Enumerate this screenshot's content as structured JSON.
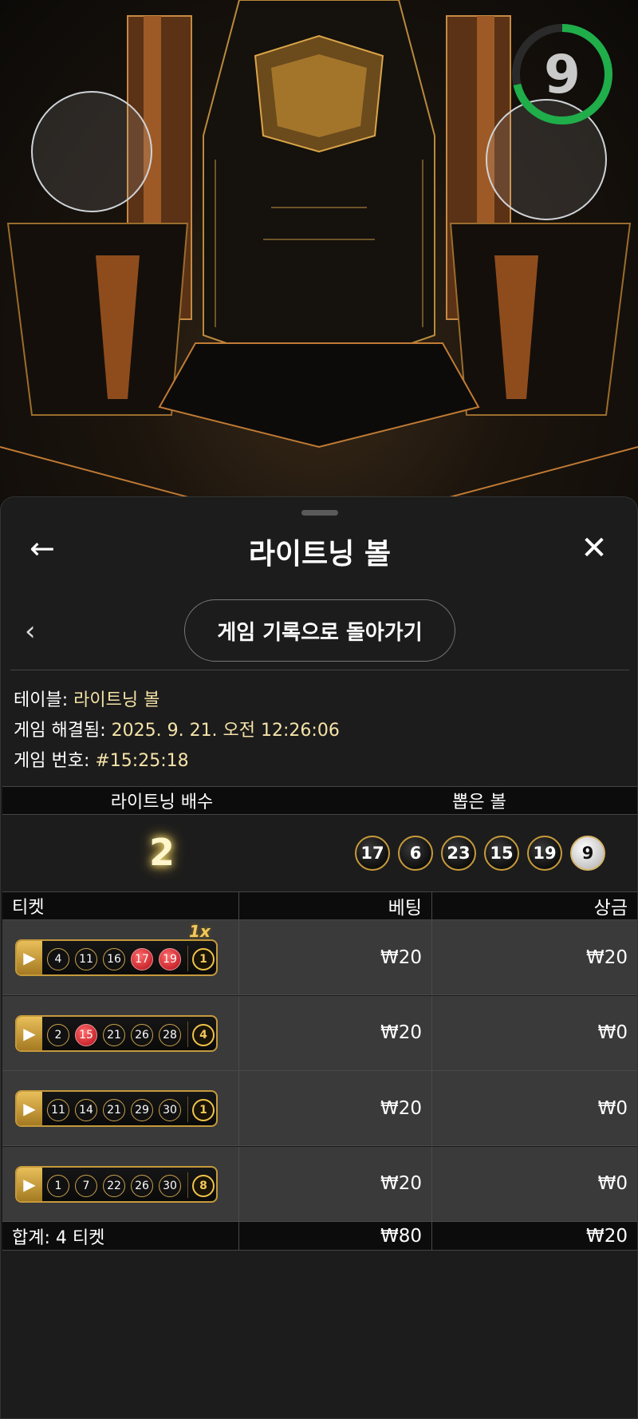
{
  "timer": {
    "value": "9",
    "color": "#1fae4a"
  },
  "header": {
    "title": "라이트닝 볼",
    "back_icon": "←",
    "close_icon": "✕"
  },
  "history": {
    "back_icon": "‹",
    "label": "게임 기록으로 돌아가기"
  },
  "info": {
    "table_label": "테이블:",
    "table_value": "라이트닝 볼",
    "resolved_label": "게임 해결됨:",
    "resolved_value": "2025. 9. 21. 오전 12:26:06",
    "game_no_label": "게임 번호:",
    "game_no_value": "#15:25:18"
  },
  "draw": {
    "col_multiplier": "라이트닝 배수",
    "col_balls": "뽑은 볼",
    "multiplier": "2",
    "balls": [
      "17",
      "6",
      "23",
      "15",
      "19",
      "9"
    ]
  },
  "tickets_table": {
    "col_ticket": "티켓",
    "col_bet": "베팅",
    "col_win": "상금",
    "rows": [
      {
        "numbers": [
          "4",
          "11",
          "16",
          "17",
          "19"
        ],
        "bonus": "1",
        "bet": "₩20",
        "win": "₩20",
        "multiplier_badge": "1x"
      },
      {
        "numbers": [
          "2",
          "15",
          "21",
          "26",
          "28"
        ],
        "bonus": "4",
        "bet": "₩20",
        "win": "₩0"
      },
      {
        "numbers": [
          "11",
          "14",
          "21",
          "29",
          "30"
        ],
        "bonus": "1",
        "bet": "₩20",
        "win": "₩0"
      },
      {
        "numbers": [
          "1",
          "7",
          "22",
          "26",
          "30"
        ],
        "bonus": "8",
        "bet": "₩20",
        "win": "₩0"
      }
    ],
    "total_label": "합계: 4 티켓",
    "total_bet": "₩80",
    "total_win": "₩20"
  }
}
